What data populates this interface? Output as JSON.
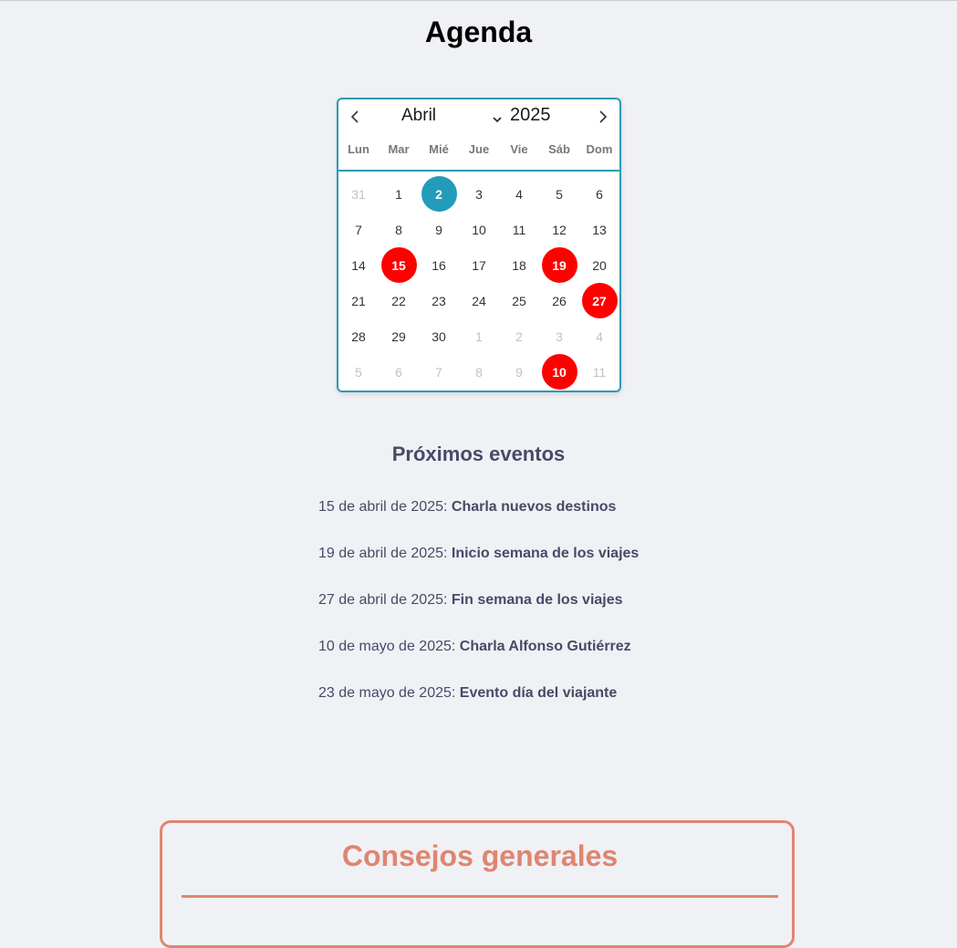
{
  "page": {
    "title": "Agenda"
  },
  "calendar": {
    "month": "Abril",
    "year": "2025",
    "prev_icon": "chevron-left-icon",
    "next_icon": "chevron-right-icon",
    "accent_color": "#2a9bb5",
    "event_color": "#ff0000",
    "weekdays": [
      "Lun",
      "Mar",
      "Mié",
      "Jue",
      "Vie",
      "Sáb",
      "Dom"
    ],
    "days": [
      {
        "label": "31",
        "state": "other"
      },
      {
        "label": "1",
        "state": "normal"
      },
      {
        "label": "2",
        "state": "today"
      },
      {
        "label": "3",
        "state": "normal"
      },
      {
        "label": "4",
        "state": "normal"
      },
      {
        "label": "5",
        "state": "normal"
      },
      {
        "label": "6",
        "state": "normal"
      },
      {
        "label": "7",
        "state": "normal"
      },
      {
        "label": "8",
        "state": "normal"
      },
      {
        "label": "9",
        "state": "normal"
      },
      {
        "label": "10",
        "state": "normal"
      },
      {
        "label": "11",
        "state": "normal"
      },
      {
        "label": "12",
        "state": "normal"
      },
      {
        "label": "13",
        "state": "normal"
      },
      {
        "label": "14",
        "state": "normal"
      },
      {
        "label": "15",
        "state": "event"
      },
      {
        "label": "16",
        "state": "normal"
      },
      {
        "label": "17",
        "state": "normal"
      },
      {
        "label": "18",
        "state": "normal"
      },
      {
        "label": "19",
        "state": "event"
      },
      {
        "label": "20",
        "state": "normal"
      },
      {
        "label": "21",
        "state": "normal"
      },
      {
        "label": "22",
        "state": "normal"
      },
      {
        "label": "23",
        "state": "normal"
      },
      {
        "label": "24",
        "state": "normal"
      },
      {
        "label": "25",
        "state": "normal"
      },
      {
        "label": "26",
        "state": "normal"
      },
      {
        "label": "27",
        "state": "event"
      },
      {
        "label": "28",
        "state": "normal"
      },
      {
        "label": "29",
        "state": "normal"
      },
      {
        "label": "30",
        "state": "normal"
      },
      {
        "label": "1",
        "state": "other"
      },
      {
        "label": "2",
        "state": "other"
      },
      {
        "label": "3",
        "state": "other"
      },
      {
        "label": "4",
        "state": "other"
      },
      {
        "label": "5",
        "state": "other"
      },
      {
        "label": "6",
        "state": "other"
      },
      {
        "label": "7",
        "state": "other"
      },
      {
        "label": "8",
        "state": "other"
      },
      {
        "label": "9",
        "state": "other"
      },
      {
        "label": "10",
        "state": "event"
      },
      {
        "label": "11",
        "state": "other"
      }
    ]
  },
  "events": {
    "title": "Próximos eventos",
    "items": [
      {
        "date": "15 de abril de 2025: ",
        "name": "Charla nuevos destinos"
      },
      {
        "date": "19 de abril de 2025: ",
        "name": "Inicio semana de los viajes"
      },
      {
        "date": "27 de abril de 2025: ",
        "name": "Fin semana de los viajes"
      },
      {
        "date": "10 de mayo de 2025: ",
        "name": "Charla Alfonso Gutiérrez"
      },
      {
        "date": "23 de mayo de 2025: ",
        "name": "Evento día del viajante"
      }
    ]
  },
  "tips": {
    "title": "Consejos generales",
    "accent_color": "#e08570"
  }
}
